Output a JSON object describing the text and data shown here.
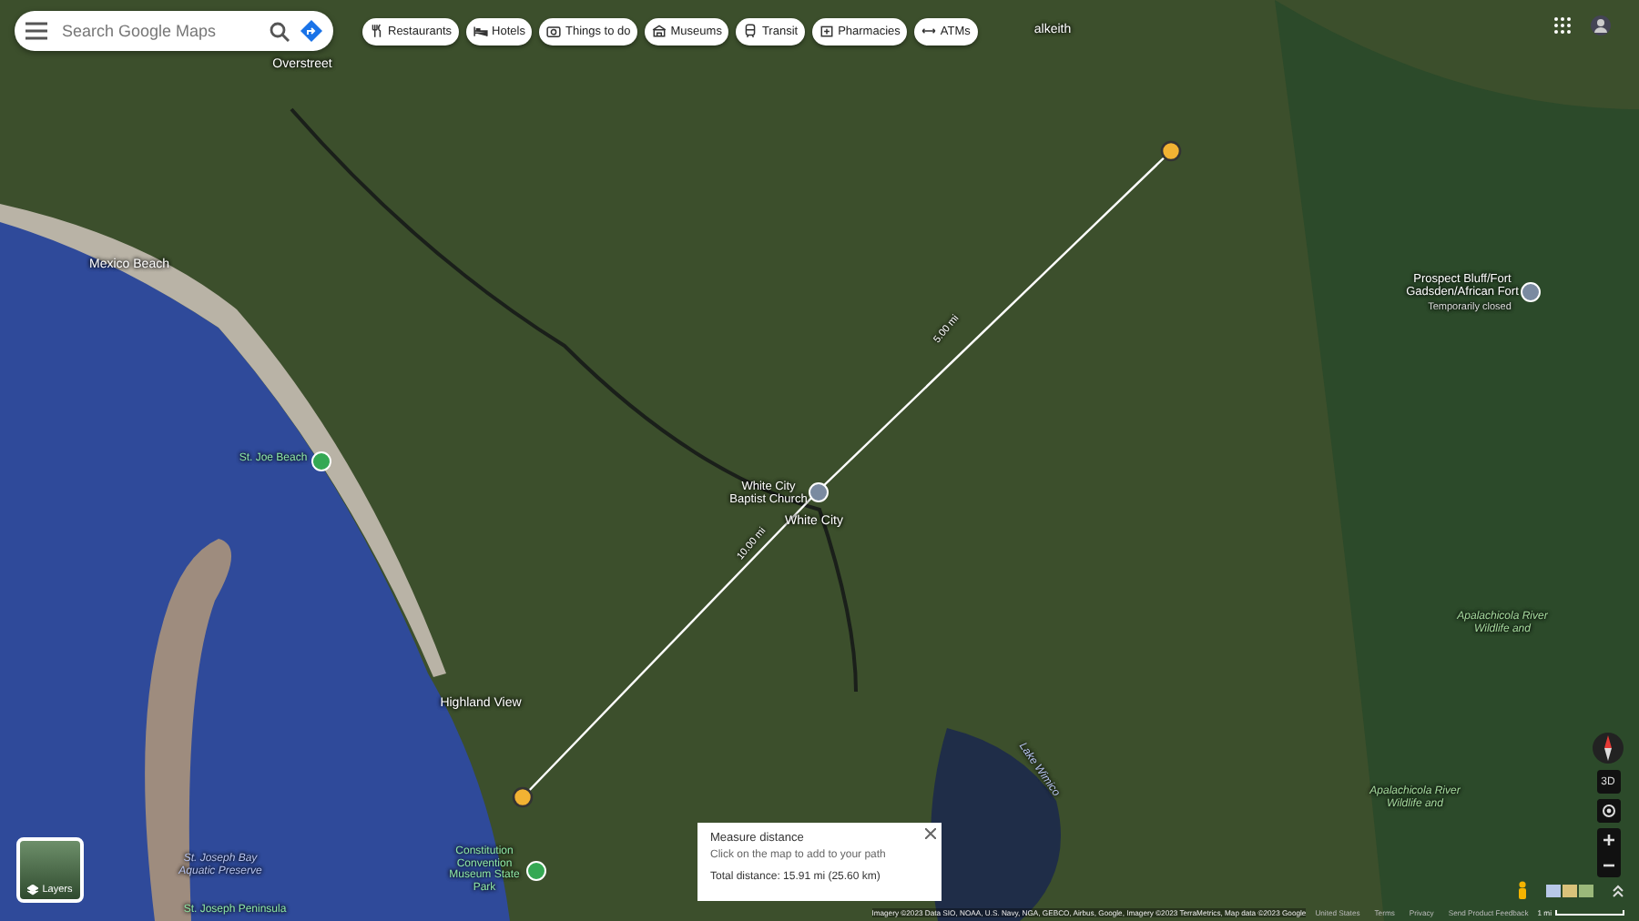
{
  "search": {
    "placeholder": "Search Google Maps"
  },
  "categories": [
    {
      "label": "Restaurants"
    },
    {
      "label": "Hotels"
    },
    {
      "label": "Things to do"
    },
    {
      "label": "Museums"
    },
    {
      "label": "Transit"
    },
    {
      "label": "Pharmacies"
    },
    {
      "label": "ATMs"
    }
  ],
  "map_labels": [
    {
      "text": "Overstreet",
      "kind": "place"
    },
    {
      "text": "alkeith",
      "kind": "place"
    },
    {
      "text": "Mexico Beach",
      "kind": "place"
    },
    {
      "text": "St. Joe Beach",
      "kind": "park"
    },
    {
      "text": "White City Baptist Church",
      "kind": "poi"
    },
    {
      "text": "White City",
      "kind": "place"
    },
    {
      "text": "Highland View",
      "kind": "place"
    },
    {
      "text": "Prospect Bluff/Fort Gadsden/African Fort",
      "kind": "poi"
    },
    {
      "text": "Temporarily closed",
      "kind": "note"
    },
    {
      "text": "Apalachicola River Wildlife and",
      "kind": "nature"
    },
    {
      "text": "Apalachicola River Wildlife and",
      "kind": "nature"
    },
    {
      "text": "Lake Wimico",
      "kind": "water"
    },
    {
      "text": "St. Joseph Bay Aquatic Preserve",
      "kind": "water"
    },
    {
      "text": "St. Joseph Peninsula",
      "kind": "park"
    },
    {
      "text": "Constitution Convention Museum State Park",
      "kind": "park"
    },
    {
      "text": "5.00 mi",
      "kind": "distance"
    },
    {
      "text": "10.00 mi",
      "kind": "distance"
    }
  ],
  "measure_card": {
    "title": "Measure distance",
    "hint": "Click on the map to add to your path",
    "total": "Total distance: 15.91 mi (25.60 km)"
  },
  "layers_button": {
    "label": "Layers"
  },
  "controls": {
    "three_d": "3D"
  },
  "footer": {
    "attribution": "Imagery ©2023 Data SIO, NOAA, U.S. Navy, NGA, GEBCO, Airbus, Google, Imagery ©2023 TerraMetrics, Map data ©2023 Google",
    "links": [
      "United States",
      "Terms",
      "Privacy",
      "Send Product Feedback"
    ],
    "scale": "1 mi"
  }
}
